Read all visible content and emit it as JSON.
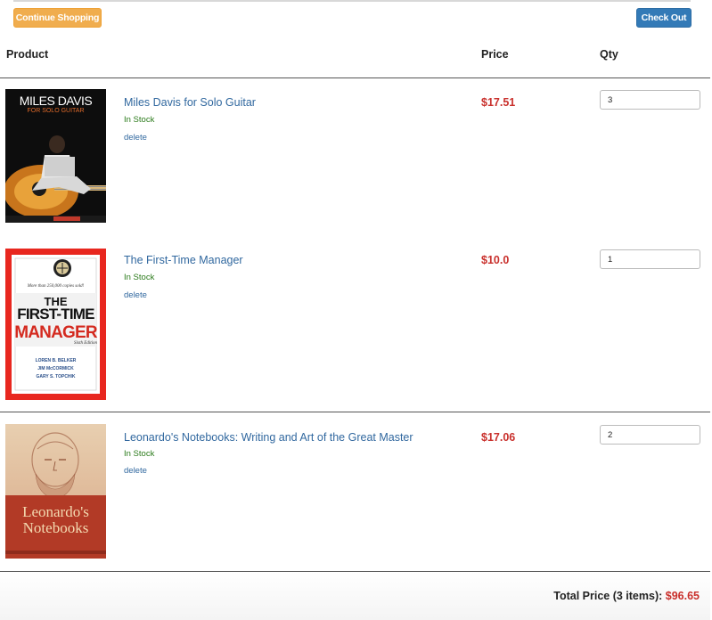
{
  "toolbar": {
    "continue_label": "Continue Shopping",
    "checkout_label": "Check Out"
  },
  "table": {
    "headers": {
      "product": "Product",
      "price": "Price",
      "qty": "Qty"
    }
  },
  "items": [
    {
      "title": "Miles Davis for Solo Guitar",
      "stock": "In Stock",
      "delete_label": "delete",
      "price": "$17.51",
      "qty": "3",
      "cover": {
        "line1": "MILES DAVIS",
        "line2": "FOR SOLO GUITAR"
      }
    },
    {
      "title": "The First-Time Manager",
      "stock": "In Stock",
      "delete_label": "delete",
      "price": "$10.0",
      "qty": "1",
      "cover": {
        "tag": "More than 250,000 copies sold!",
        "line1": "THE",
        "line2": "FIRST-TIME",
        "line3": "MANAGER",
        "edition": "Sixth Edition",
        "authors": [
          "LOREN B. BELKER",
          "JIM McCORMICK",
          "GARY S. TOPCHIK"
        ]
      }
    },
    {
      "title": "Leonardo's Notebooks: Writing and Art of the Great Master",
      "stock": "In Stock",
      "delete_label": "delete",
      "price": "$17.06",
      "qty": "2",
      "cover": {
        "line1": "Leonardo's",
        "line2": "Notebooks"
      }
    }
  ],
  "summary": {
    "label": "Total Price (3 items):",
    "amount": "$96.65"
  },
  "colors": {
    "accent_price": "#c9302c",
    "link": "#31689f",
    "stock": "#2a7a1a",
    "warning": "#f0ad4e",
    "primary": "#337ab7"
  }
}
